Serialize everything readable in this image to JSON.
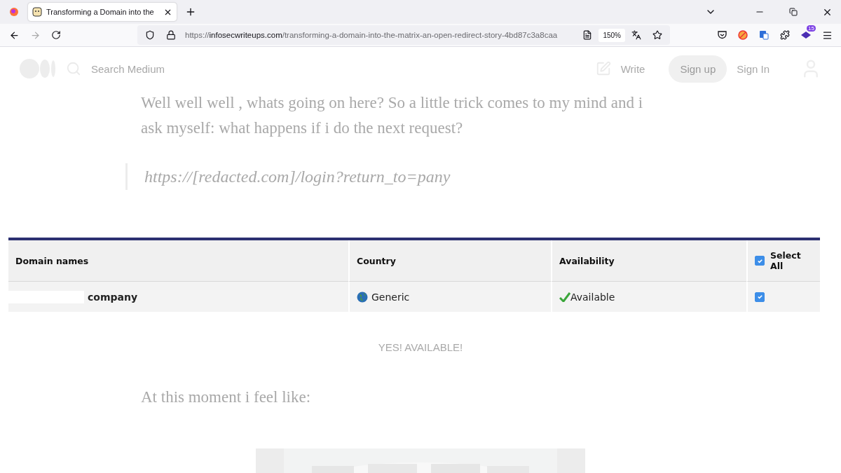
{
  "browser": {
    "tabs": [
      {
        "title": "Transforming a Domain into the",
        "selected": true
      }
    ],
    "url": {
      "scheme": "https://",
      "domain": "infosecwriteups.com",
      "path": "/transforming-a-domain-into-the-matrix-an-open-redirect-story-4bd87c3a8caa"
    },
    "zoom": "150%",
    "extension_badge": "15"
  },
  "site_header": {
    "search_placeholder": "Search Medium",
    "write": "Write",
    "sign_up": "Sign up",
    "sign_in": "Sign In"
  },
  "article": {
    "paragraph_lines": [
      "Well well well , whats going on here? So a little trick comes to my mind and i",
      "ask myself: what happens if i do the next request?"
    ],
    "quote": "https://[redacted.com]/login?return_to=pany",
    "table": {
      "columns": [
        "Domain names",
        "Country",
        "Availability",
        "Select All"
      ],
      "select_all_checked": true,
      "rows": [
        {
          "domain": "company",
          "country": "Generic",
          "availability": "Available",
          "checked": true
        }
      ]
    },
    "caption": "YES! AVAILABLE!",
    "paragraph": "At this moment i feel like:"
  }
}
